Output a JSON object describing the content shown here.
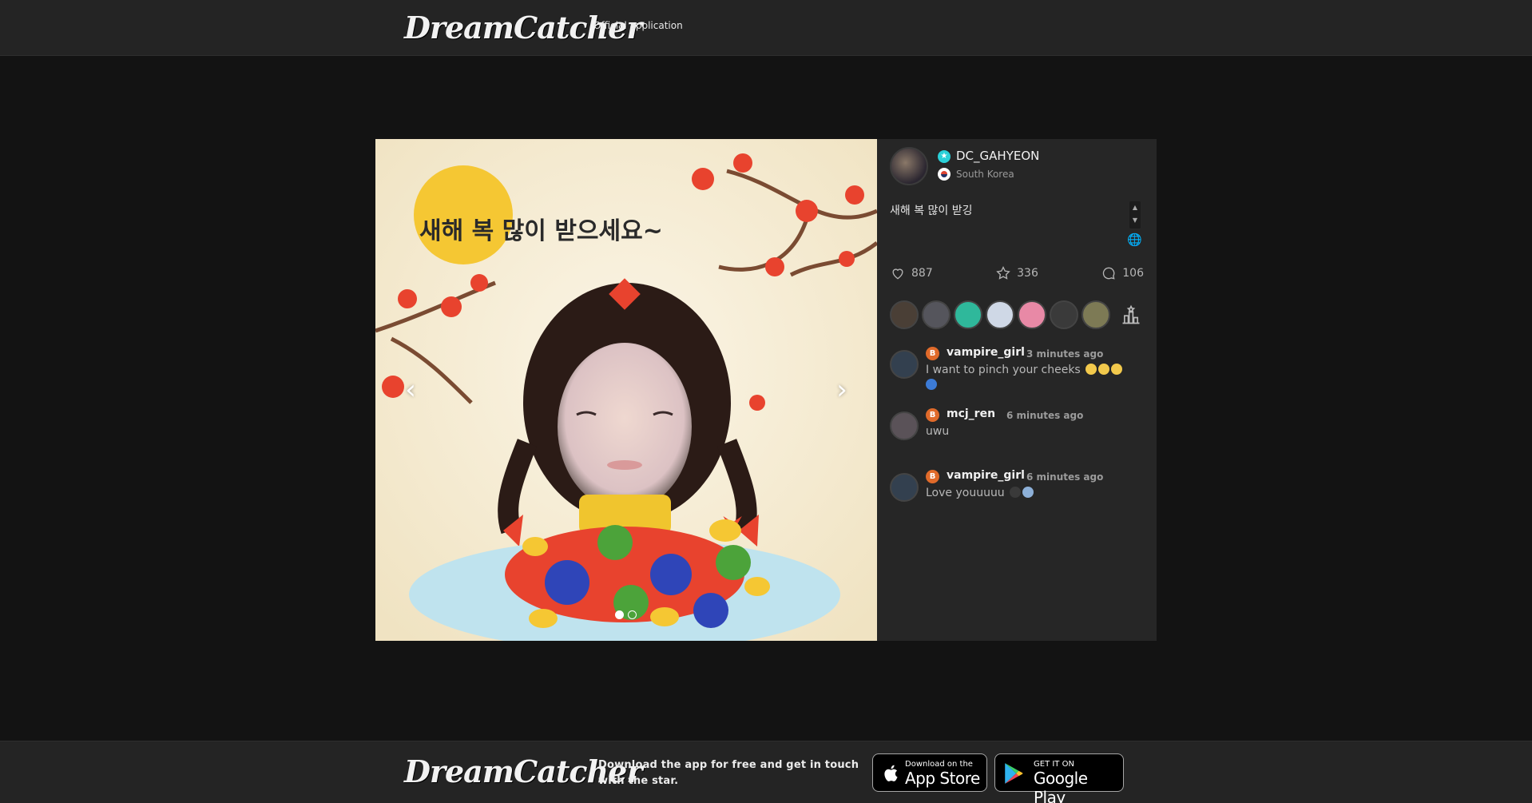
{
  "header": {
    "logo": "DreamCatcher",
    "tagline": "Official application"
  },
  "post": {
    "image": {
      "overlay_text": "새해 복 많이 받으세요~",
      "slide_count": 2,
      "active_slide": 1
    },
    "author": {
      "name": "DC_GAHYEON",
      "country": "South Korea",
      "verified": true
    },
    "caption": "새해 복 많이 받깅",
    "stats": {
      "likes": "887",
      "favorites": "336",
      "comments": "106"
    },
    "fans": [
      {
        "icon": "fan-avatar",
        "color": "#4a3f36"
      },
      {
        "icon": "fan-avatar",
        "color": "#55555c"
      },
      {
        "icon": "fan-avatar",
        "color": "#2fb89b"
      },
      {
        "icon": "fan-avatar",
        "color": "#cfd8e6"
      },
      {
        "icon": "fan-avatar",
        "color": "#e889a6"
      },
      {
        "icon": "fan-avatar",
        "color": "#3a3a3a"
      },
      {
        "icon": "fan-avatar",
        "color": "#7d7a55"
      }
    ],
    "comments": [
      {
        "badge": "B",
        "user": "vampire_girl",
        "time": "3 minutes ago",
        "text": "I want to pinch your cheeks",
        "emojis": [
          "#f2c94c",
          "#f2c94c",
          "#f2c94c",
          "#3c7bd6"
        ]
      },
      {
        "badge": "B",
        "user": "mcj_ren",
        "time": "6 minutes ago",
        "text": "uwu",
        "emojis": []
      },
      {
        "badge": "B",
        "user": "vampire_girl",
        "time": "6 minutes ago",
        "text": "Love youuuuu",
        "emojis": [
          "#3a3a3a",
          "#8db0d8"
        ]
      }
    ]
  },
  "footer": {
    "logo": "DreamCatcher",
    "text": "Download the app for free and get in touch with the star.",
    "appstore_small": "Download on the",
    "appstore_big": "App Store",
    "playstore_small": "GET IT ON",
    "playstore_big": "Google Play"
  },
  "colors": {
    "background": "#131313",
    "bar": "#242424",
    "card": "#262626",
    "badge": "#e06a2a",
    "verified": "#2ad0d8"
  }
}
